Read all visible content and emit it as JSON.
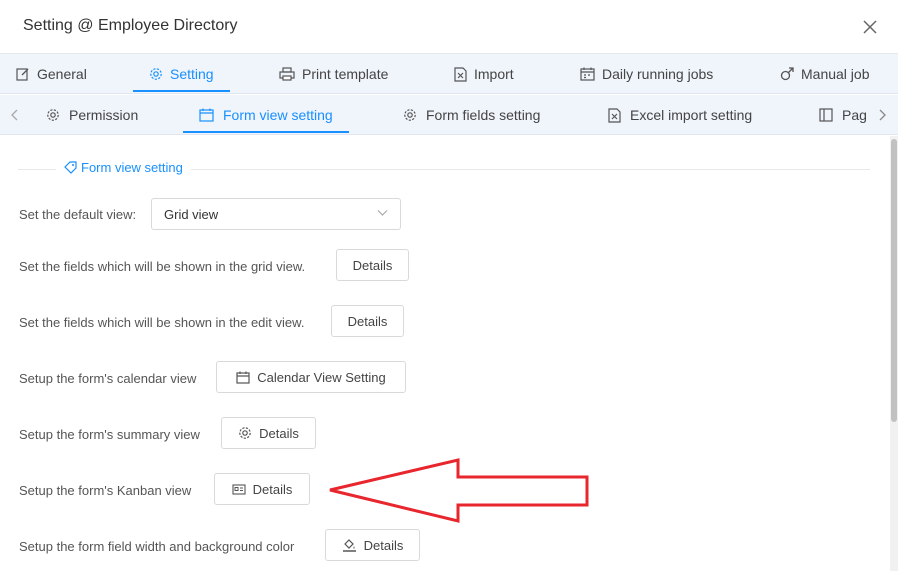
{
  "window": {
    "title": "Setting @ Employee Directory",
    "close_icon": "close-icon"
  },
  "top_tabs": [
    {
      "label": "General",
      "icon": "edit-icon",
      "active": false
    },
    {
      "label": "Setting",
      "icon": "gear-icon",
      "active": true
    },
    {
      "label": "Print template",
      "icon": "printer-icon",
      "active": false
    },
    {
      "label": "Import",
      "icon": "excel-file-icon",
      "active": false
    },
    {
      "label": "Daily running jobs",
      "icon": "calendar-icon",
      "active": false
    },
    {
      "label": "Manual job",
      "icon": "male-icon",
      "active": false
    }
  ],
  "sub_tabs": [
    {
      "label": "Permission",
      "icon": "gear-icon",
      "active": false
    },
    {
      "label": "Form view setting",
      "icon": "calendar-icon",
      "active": true
    },
    {
      "label": "Form fields setting",
      "icon": "gear-icon",
      "active": false
    },
    {
      "label": "Excel import setting",
      "icon": "excel-file-icon",
      "active": false
    },
    {
      "label": "Pag",
      "icon": "layout-icon",
      "active": false
    }
  ],
  "section": {
    "title": "Form view setting",
    "icon": "tag-icon"
  },
  "settings": {
    "default_view_label": "Set the default view:",
    "default_view_value": "Grid view",
    "grid_fields_label": "Set the fields which will be shown in the grid view.",
    "grid_fields_button": "Details",
    "edit_fields_label": "Set the fields which will be shown in the edit view.",
    "edit_fields_button": "Details",
    "calendar_label": "Setup the form's calendar view",
    "calendar_button": "Calendar View Setting",
    "summary_label": "Setup the form's summary view",
    "summary_button": "Details",
    "kanban_label": "Setup the form's Kanban view",
    "kanban_button": "Details",
    "field_width_label": "Setup the form field width and background color",
    "field_width_button": "Details"
  },
  "colors": {
    "accent": "#1890ff",
    "annotation": "#e8262e",
    "tab_bar_bg": "#f0f4fb"
  }
}
